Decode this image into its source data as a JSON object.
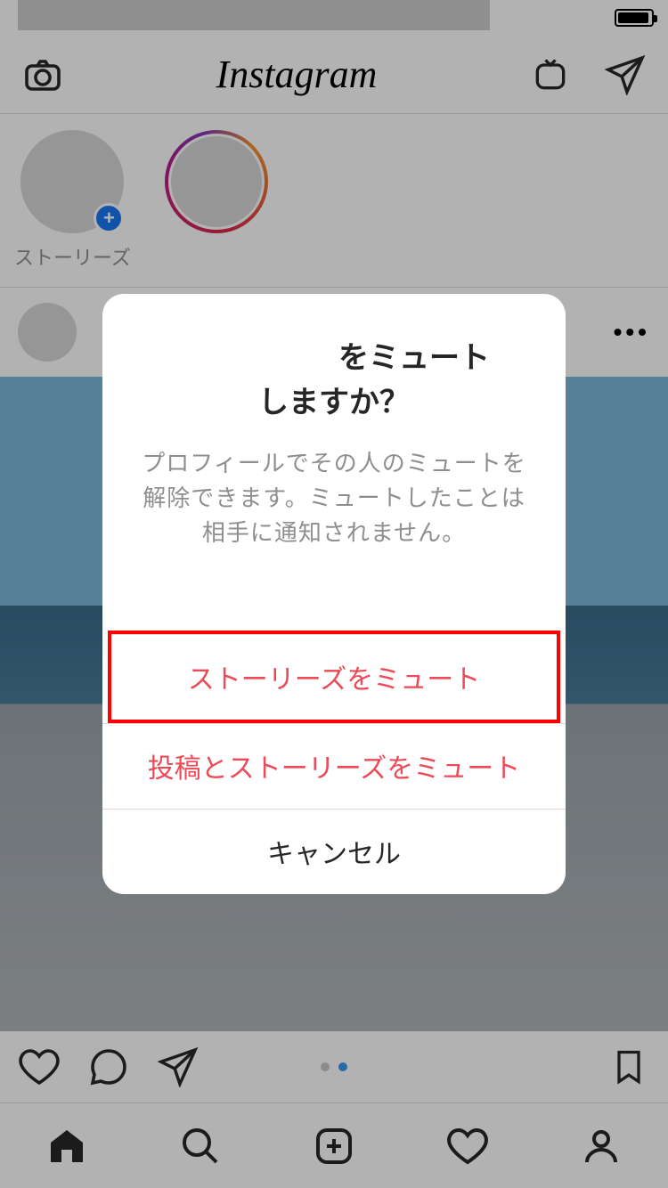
{
  "status": {
    "battery_icon": "battery-icon"
  },
  "nav": {
    "logo": "Instagram",
    "camera_icon": "camera-icon",
    "igtv_icon": "igtv-icon",
    "messages_icon": "paper-plane-icon"
  },
  "stories": {
    "items": [
      {
        "label": "ストーリーズ",
        "has_plus": true,
        "has_ring": false
      },
      {
        "label": "",
        "has_plus": false,
        "has_ring": true
      }
    ]
  },
  "post": {
    "more": "•••"
  },
  "indicator": {
    "total": 2,
    "active": 1
  },
  "tabs": {
    "home": "home-icon",
    "search": "search-icon",
    "add": "add-post-icon",
    "activity": "heart-icon",
    "profile": "profile-icon"
  },
  "modal": {
    "title_line1": "をミュート",
    "title_line2": "しますか？",
    "description": "プロフィールでその人のミュートを解除できます。ミュートしたことは相手に通知されません。",
    "mute_stories": "ストーリーズをミュート",
    "mute_posts_stories": "投稿とストーリーズをミュート",
    "cancel": "キャンセル"
  }
}
